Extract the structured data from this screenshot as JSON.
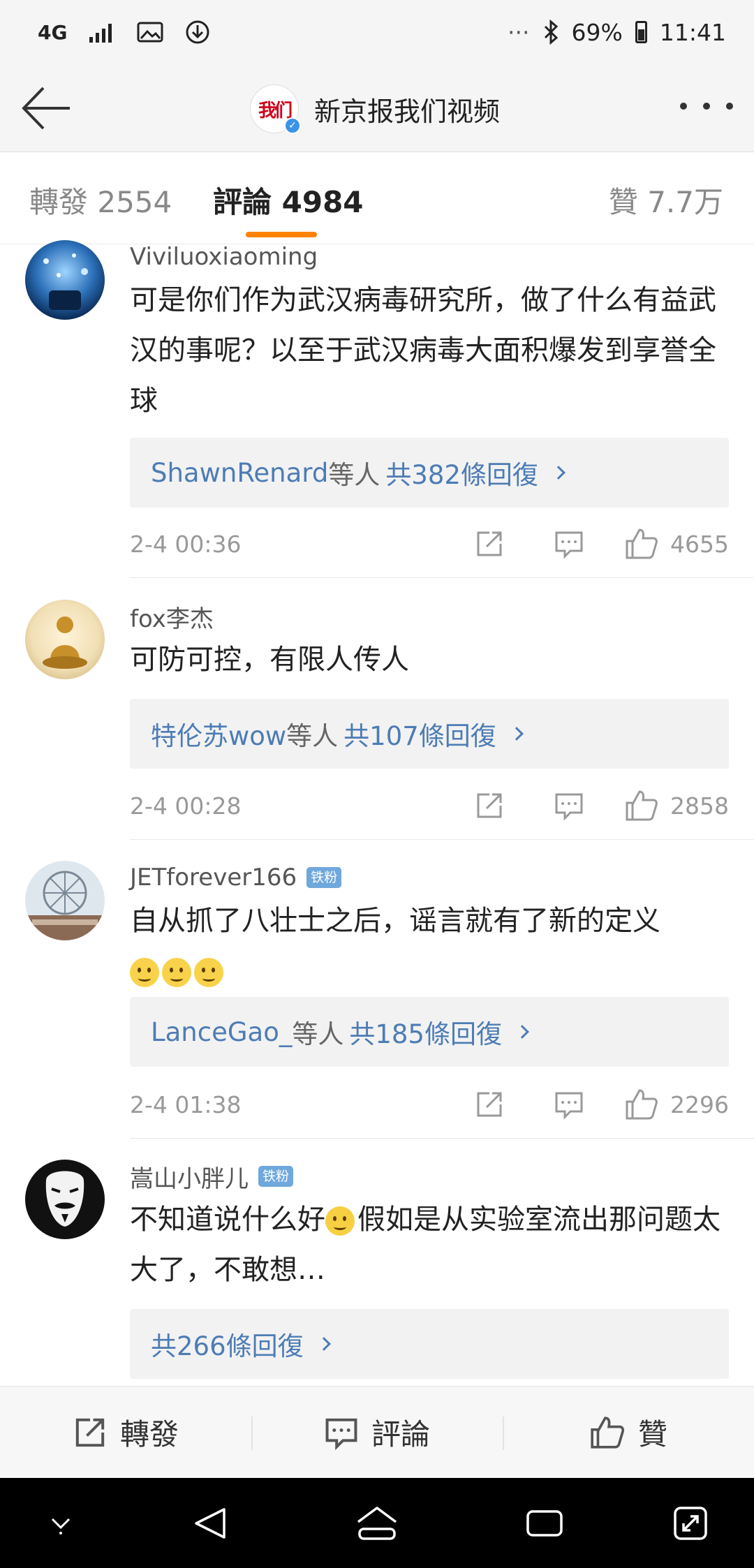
{
  "status_bar": {
    "network": "4G",
    "battery_percent": "69%",
    "time": "11:41",
    "dots": "···"
  },
  "title_bar": {
    "logo_text": "我们",
    "verified_mark": "✓",
    "title": "新京报我们视频"
  },
  "tabs": [
    {
      "label": "轉發 2554"
    },
    {
      "label": "評論 4984",
      "active": true
    },
    {
      "label": "贊 7.7万"
    }
  ],
  "comments": [
    {
      "username": "Viviluoxiaoming",
      "badge": "",
      "text": "可是你们作为武汉病毒研究所，做了什么有益武汉的事呢？以至于武汉病毒大面积爆发到享誉全球",
      "reply_names": "ShawnRenard",
      "reply_mid": "等人",
      "reply_count": "共382條回復",
      "time": "2-4 00:36",
      "likes": "4655"
    },
    {
      "username": "fox李杰",
      "badge": "",
      "text": "可防可控，有限人传人",
      "reply_names": "特伦苏wow",
      "reply_mid": "等人",
      "reply_count": "共107條回復",
      "time": "2-4 00:28",
      "likes": "2858"
    },
    {
      "username": "JETforever166",
      "badge": "铁粉",
      "text": "自从抓了八壮士之后，谣言就有了新的定义",
      "reply_names": "LanceGao_",
      "reply_mid": "等人",
      "reply_count": "共185條回復",
      "time": "2-4 01:38",
      "likes": "2296"
    },
    {
      "username": "嵩山小胖儿",
      "badge": "铁粉",
      "text_before_emoji": "不知道说什么好",
      "text_after_emoji": "假如是从实验室流出那问题太大了，不敢想…",
      "reply_names": "",
      "reply_mid": "",
      "reply_count": "共266條回復"
    }
  ],
  "action_bar": {
    "repost_label": "轉發",
    "comment_label": "評論",
    "like_label": "贊"
  },
  "colors": {
    "accent": "#ff8200",
    "link": "#4d7cb4",
    "badge": "#6fa8dc"
  }
}
